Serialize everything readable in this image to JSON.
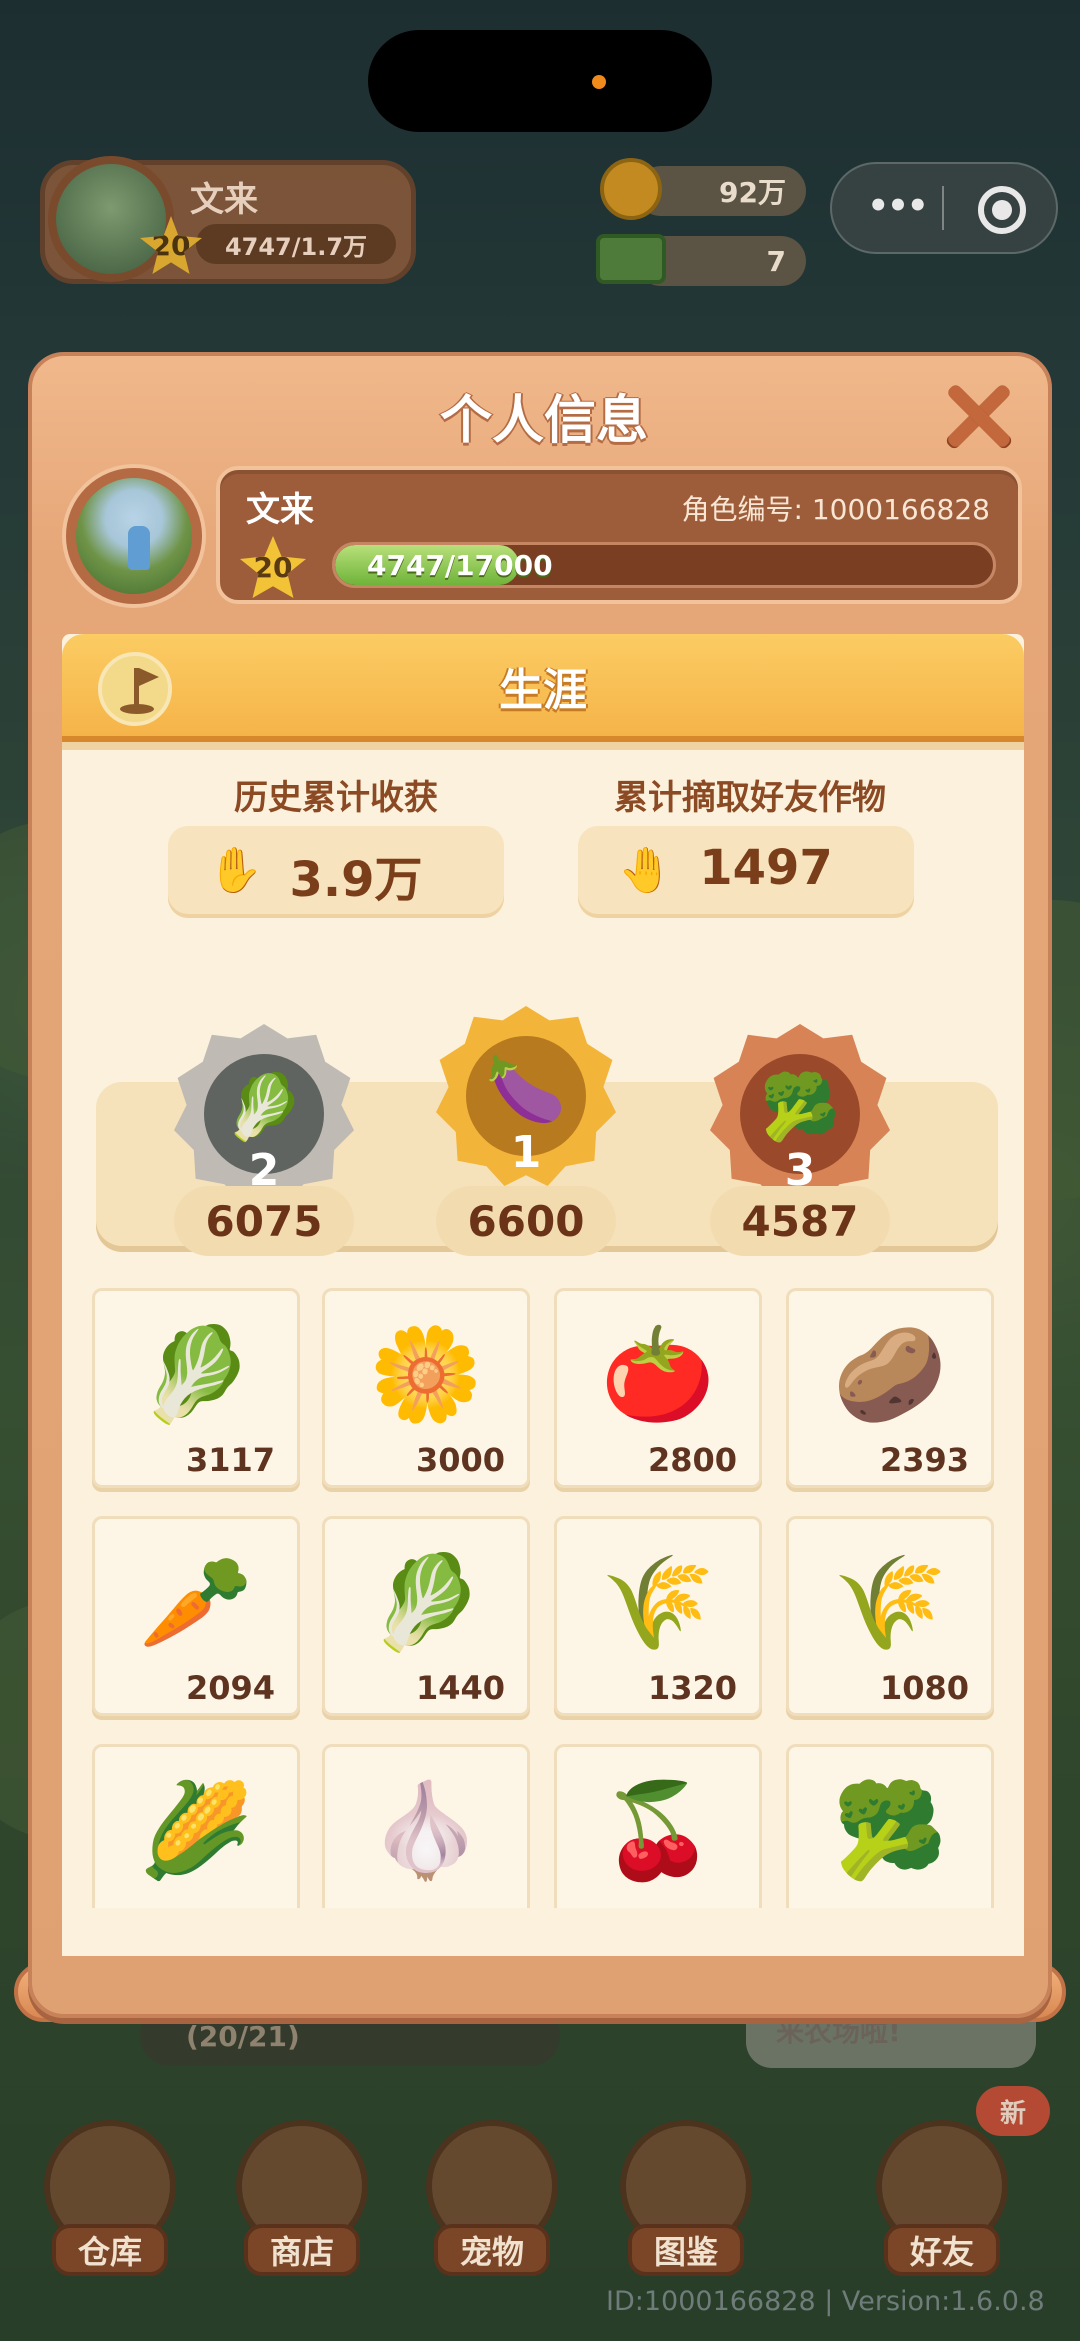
{
  "background": {
    "player_name": "文来",
    "level": "20",
    "exp_short": "4747/1.7万",
    "coins": "92万",
    "cash": "7",
    "menu_dots": "•••",
    "task_progress": "(20/21)",
    "bubble_text": "来农场啦!",
    "new_badge": "新",
    "bottom_nav": [
      "仓库",
      "商店",
      "宠物",
      "图鉴",
      "好友"
    ],
    "footer": "ID:1000166828 | Version:1.6.0.8"
  },
  "modal": {
    "title": "个人信息",
    "name": "文来",
    "role_id_label": "角色编号:",
    "role_id": "1000166828",
    "level": "20",
    "exp_text": "4747/17000",
    "exp_fraction": 0.279,
    "section_title": "生涯",
    "stats": {
      "harvest_label": "历史累计收获",
      "harvest_value": "3.9万",
      "steal_label": "累计摘取好友作物",
      "steal_value": "1497"
    },
    "podium": [
      {
        "rank": "2",
        "crop": "chinese-cabbage",
        "icon": "🥬",
        "value": "6075",
        "color": "#bfbab3"
      },
      {
        "rank": "1",
        "crop": "eggplant",
        "icon": "🍆",
        "value": "6600",
        "color": "#f3b43a"
      },
      {
        "rank": "3",
        "crop": "bok-choy",
        "icon": "🥦",
        "value": "4587",
        "color": "#d78356"
      }
    ],
    "crops": [
      {
        "name": "chinese-cabbage",
        "icon": "🥬",
        "count": "3117"
      },
      {
        "name": "dandelion",
        "icon": "🌼",
        "count": "3000"
      },
      {
        "name": "tomato",
        "icon": "🍅",
        "count": "2800"
      },
      {
        "name": "potato",
        "icon": "🥔",
        "count": "2393"
      },
      {
        "name": "carrot",
        "icon": "🥕",
        "count": "2094"
      },
      {
        "name": "spinach",
        "icon": "🥬",
        "count": "1440"
      },
      {
        "name": "rice",
        "icon": "🌾",
        "count": "1320"
      },
      {
        "name": "wheat",
        "icon": "🌾",
        "count": "1080"
      },
      {
        "name": "corn",
        "icon": "🌽",
        "count": ""
      },
      {
        "name": "garlic",
        "icon": "🧄",
        "count": ""
      },
      {
        "name": "lychee",
        "icon": "🍒",
        "count": ""
      },
      {
        "name": "cauliflower",
        "icon": "🥦",
        "count": ""
      }
    ]
  }
}
